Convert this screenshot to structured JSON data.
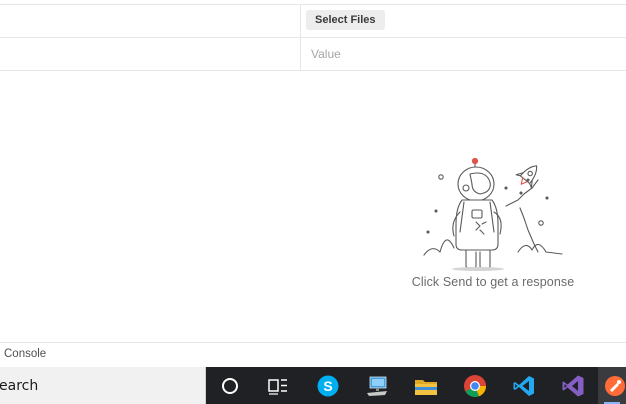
{
  "form": {
    "file_row": {
      "select_files_label": "Select Files"
    },
    "value_row": {
      "value_placeholder": "Value"
    }
  },
  "response": {
    "empty_message": "Click Send to get a response"
  },
  "console": {
    "label": "Console"
  },
  "taskbar": {
    "search_text": "earch",
    "icons": [
      "cortana-icon",
      "task-view-icon",
      "skype-icon",
      "computer-icon",
      "file-explorer-icon",
      "chrome-icon",
      "vscode-icon",
      "visual-studio-icon",
      "postman-icon"
    ],
    "colors": {
      "taskbar_bg": "#202124",
      "skype": "#00aff0",
      "vscode": "#23a9f2",
      "visual_studio": "#865fc5",
      "postman": "#ff6c37",
      "folder": "#f4c242"
    }
  }
}
